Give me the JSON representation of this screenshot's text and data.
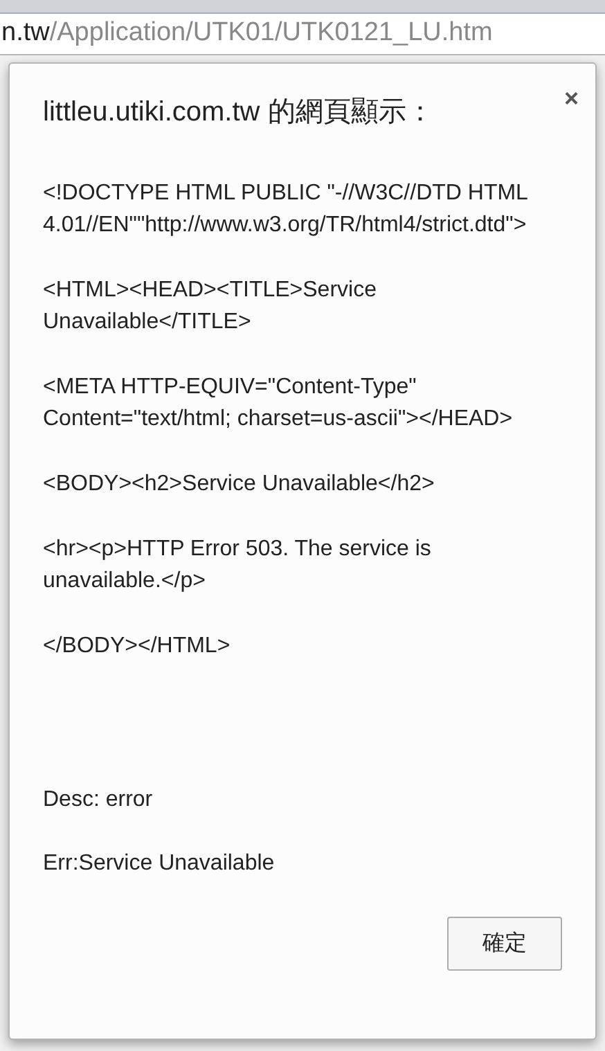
{
  "address_bar": {
    "host": "n.tw",
    "path": "/Application/UTK01/UTK0121_LU.htm"
  },
  "dialog": {
    "title": "littleu.utiki.com.tw 的網頁顯示：",
    "close": "×",
    "message": [
      "<!DOCTYPE HTML PUBLIC \"-//W3C//DTD HTML 4.01//EN\"\"http://www.w3.org/TR/html4/strict.dtd\">",
      "<HTML><HEAD><TITLE>Service Unavailable</TITLE>",
      "<META HTTP-EQUIV=\"Content-Type\" Content=\"text/html; charset=us-ascii\"></HEAD>",
      "<BODY><h2>Service Unavailable</h2>",
      "<hr><p>HTTP Error 503. The service is unavailable.</p>",
      "</BODY></HTML>"
    ],
    "details": [
      "Desc: error",
      "Err:Service Unavailable"
    ],
    "ok_button": "確定"
  }
}
